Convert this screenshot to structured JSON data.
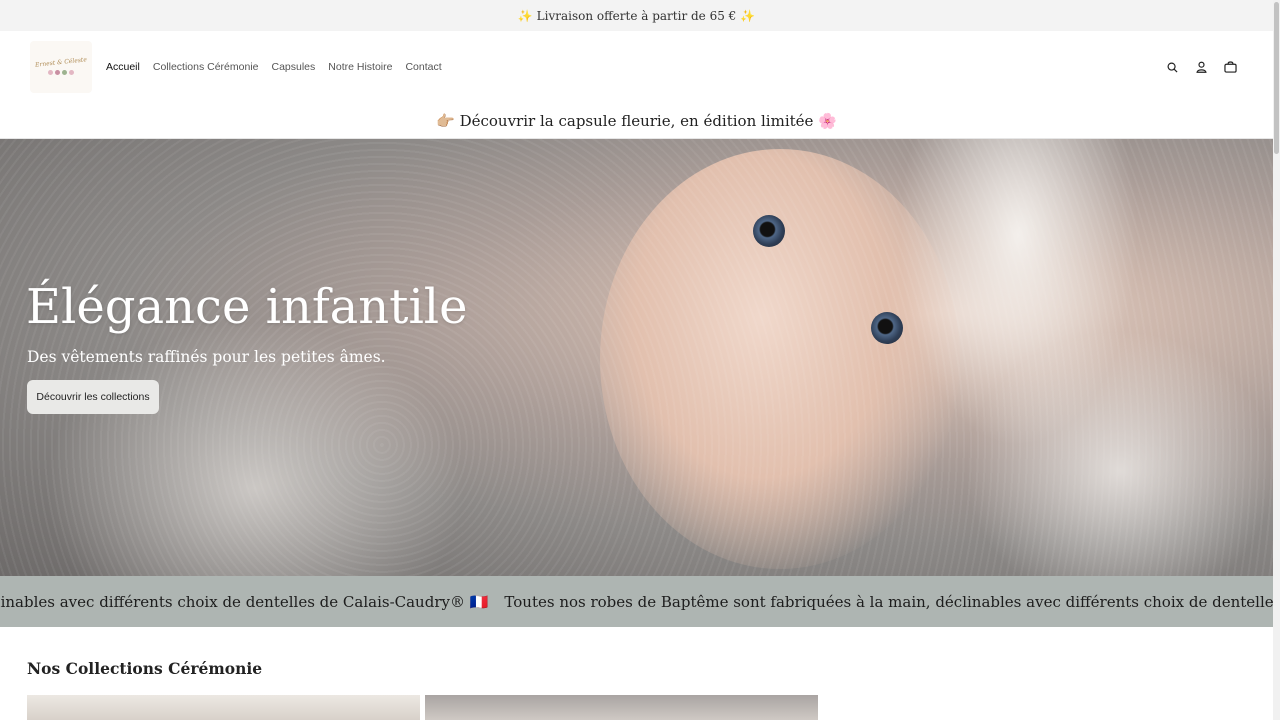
{
  "announcement": {
    "text": "✨ Livraison offerte à partir de 65 € ✨"
  },
  "header": {
    "logo_text": "Ernest & Céleste",
    "nav": [
      {
        "label": "Accueil",
        "active": true
      },
      {
        "label": "Collections Cérémonie",
        "active": false
      },
      {
        "label": "Capsules",
        "active": false
      },
      {
        "label": "Notre Histoire",
        "active": false
      },
      {
        "label": "Contact",
        "active": false
      }
    ],
    "icons": [
      "search-icon",
      "account-icon",
      "cart-icon"
    ]
  },
  "promo": {
    "text": "👉🏼 Découvrir la capsule fleurie, en édition limitée 🌸"
  },
  "hero": {
    "title": "Élégance infantile",
    "subtitle": "Des vêtements raffinés pour les petites âmes.",
    "button_label": "Découvrir les collections"
  },
  "marquee": {
    "items": [
      "Toutes nos robes de Baptême sont fabriquées à la main, déclinables avec différents choix de dentelles de Calais-Caudry® 🇫🇷",
      "Toutes nos robes de Baptême sont fabriquées à la main, déclinables avec différents choix de dentelles de Calais-Caudry® 🇫🇷"
    ]
  },
  "collections": {
    "title": "Nos Collections Cérémonie"
  },
  "colors": {
    "announcement_bg": "#f3f3f3",
    "marquee_bg": "#aeb5b2",
    "button_bg": "#e9e9e7",
    "text": "#222222"
  }
}
